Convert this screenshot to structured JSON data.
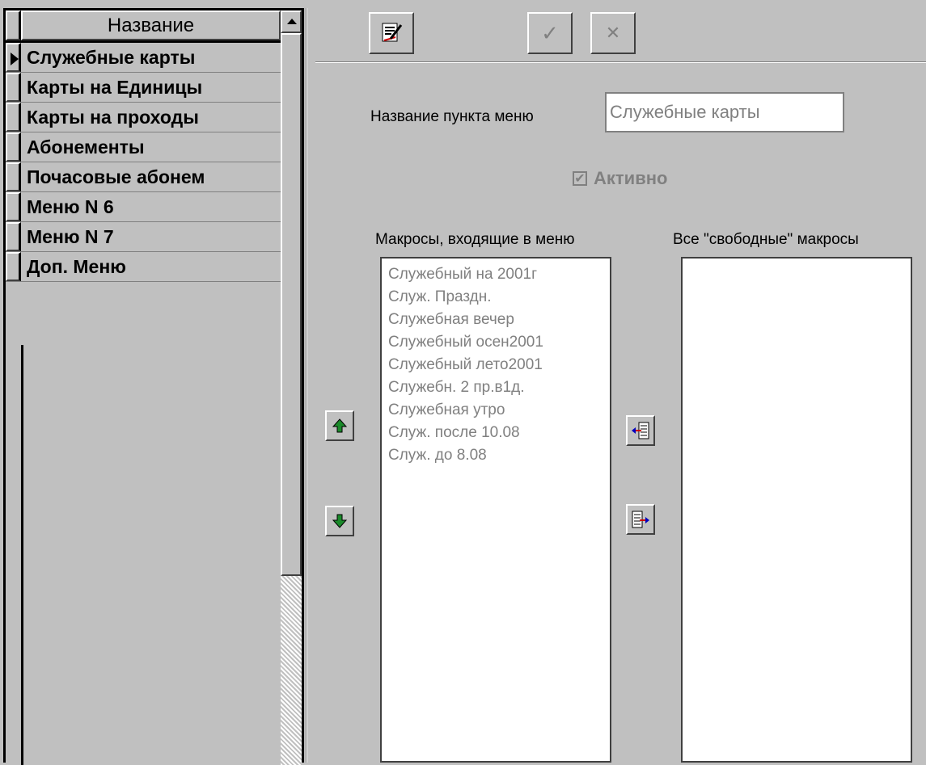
{
  "grid": {
    "header": "Название",
    "rows": [
      {
        "label": "Служебные карты",
        "current": true
      },
      {
        "label": "Карты на Единицы"
      },
      {
        "label": "Карты на проходы"
      },
      {
        "label": "Абонементы"
      },
      {
        "label": "Почасовые абонем"
      },
      {
        "label": "Меню N 6"
      },
      {
        "label": "Меню N 7"
      },
      {
        "label": "Доп. Меню"
      }
    ]
  },
  "toolbar": {
    "edit_icon": "edit-note-icon",
    "confirm_icon": "checkmark-icon",
    "cancel_icon": "cross-icon"
  },
  "form": {
    "name_label": "Название пункта меню",
    "name_value": "Служебные карты",
    "active_label": "Активно",
    "active_checked": true
  },
  "macros": {
    "included_label": "Макросы, входящие в меню",
    "free_label": "Все \"свободные\" макросы",
    "included": [
      "Служебный на 2001г",
      "Служ. Праздн.",
      "Служебная вечер",
      "Служебный осен2001",
      "Служебный лето2001",
      "Служебн. 2 пр.в1д.",
      "Служебная утро",
      "Служ. после 10.08",
      "Служ. до 8.08"
    ],
    "free": []
  },
  "colors": {
    "background": "#c0c0c0",
    "disabled_text": "#808080",
    "arrow_green": "#1a8a2a"
  }
}
